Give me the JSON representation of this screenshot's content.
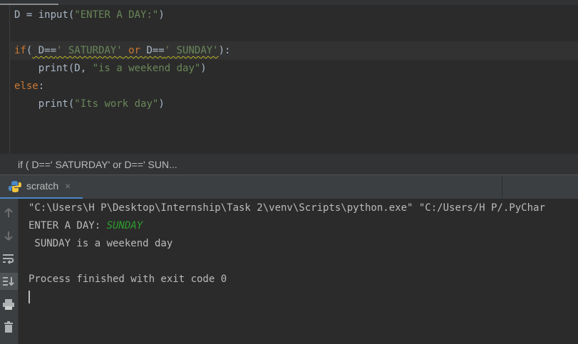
{
  "editor": {
    "line1": {
      "var": "D",
      "eq": " = ",
      "fn": "input",
      "open": "(",
      "arg": "\"ENTER A DAY:\"",
      "close": ")"
    },
    "line3": {
      "kw_if": "if",
      "open": "(",
      "a": " D==",
      "s1": "' SATURDAY'",
      "or": " or ",
      "b": "D==",
      "s2": "' SUNDAY'",
      "close": "):"
    },
    "line4": {
      "fn": "    print",
      "open": "(D, ",
      "s": "\"is a weekend day\"",
      "close": ")"
    },
    "line5": {
      "kw_else": "else",
      "colon": ":"
    },
    "line6": {
      "fn": "    print",
      "open": "(",
      "s": "\"Its work day\"",
      "close": ")"
    }
  },
  "breadcrumb": {
    "text": "if ( D==' SATURDAY' or D==' SUN..."
  },
  "run_tab": {
    "label": "scratch",
    "close": "×",
    "icon": "python-icon"
  },
  "toolbar_icons": [
    "up-arrow-icon",
    "down-arrow-icon",
    "soft-wrap-icon",
    "scroll-to-end-icon",
    "print-icon",
    "trash-icon"
  ],
  "console": {
    "command": "\"C:\\Users\\H P\\Desktop\\Internship\\Task 2\\venv\\Scripts\\python.exe\" \"C:/Users/H P/.PyChar",
    "prompt": "ENTER A DAY: ",
    "user_input": "SUNDAY",
    "result": " SUNDAY is a weekend day",
    "finished": "Process finished with exit code 0"
  },
  "colors": {
    "background": "#2b2b2b",
    "keyword": "#cc7832",
    "string": "#6a8759",
    "text": "#a9b7c6",
    "input": "#2e9e2e"
  }
}
